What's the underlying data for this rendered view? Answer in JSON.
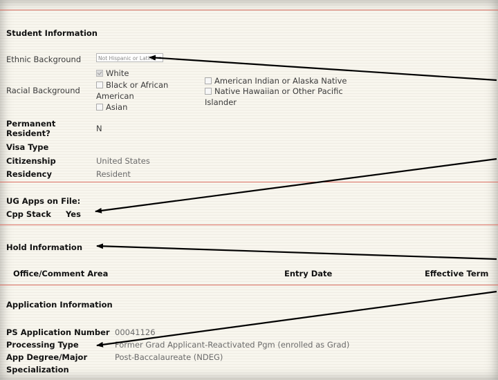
{
  "student_info": {
    "heading": "Student Information",
    "ethnic_label": "Ethnic Background",
    "ethnic_value": "Not Hispanic or Latino",
    "racial_label": "Racial Background",
    "race_options": {
      "white": "White",
      "black_line1": "Black or African",
      "black_line2": "American",
      "asian": "Asian",
      "native_american": "American Indian or Alaska Native",
      "pacific_line1": "Native Hawaiian or Other Pacific",
      "pacific_line2": "Islander"
    },
    "permanent_label_line1": "Permanent",
    "permanent_label_line2": "Resident?",
    "permanent_value": "N",
    "visa_label": "Visa Type",
    "citizenship_label": "Citizenship",
    "citizenship_value": "United States",
    "residency_label": "Residency",
    "residency_value": "Resident"
  },
  "ug_apps": {
    "heading": "UG Apps on File:",
    "cpp_label": "Cpp Stack",
    "cpp_value": "Yes"
  },
  "hold_info": {
    "heading": "Hold Information",
    "columns": [
      "Office/Comment Area",
      "Entry Date",
      "Effective Term"
    ]
  },
  "application_info": {
    "heading": "Application Information",
    "ps_number_label": "PS Application Number",
    "ps_number_value": "00041126",
    "processing_type_label": "Processing Type",
    "processing_type_value": "Former Grad Applicant-Reactivated Pgm (enrolled as Grad)",
    "degree_label": "App Degree/Major",
    "degree_value": "Post-Baccalaureate (NDEG)",
    "specialization_label": "Specialization"
  }
}
